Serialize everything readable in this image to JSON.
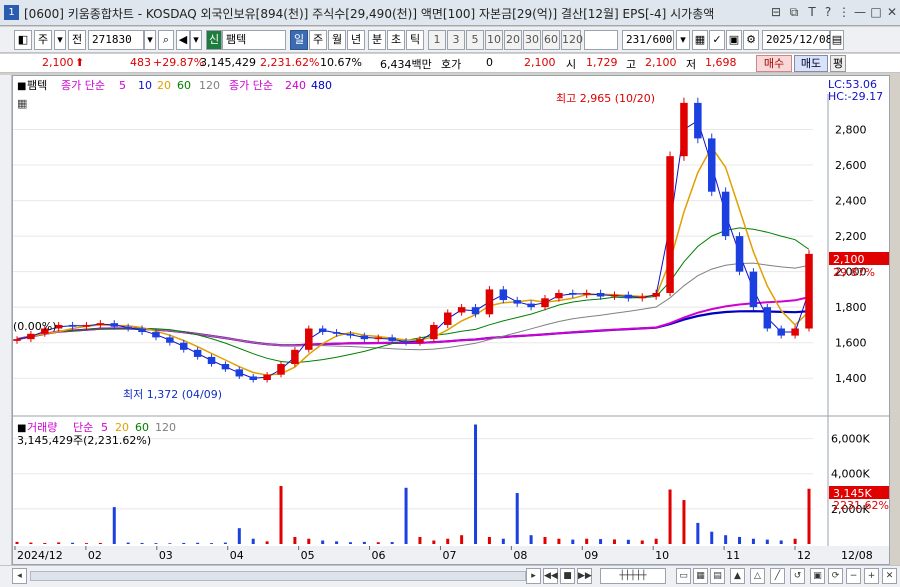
{
  "window": {
    "number": "1",
    "title": "[0600] 키움종합차트 - KOSDAQ 외국인보유[894(천)] 주식수[29,490(천)] 액면[100] 자본금[29(억)] 결산[12월] EPS[-4] 시가총액"
  },
  "toolbar": {
    "period_labels": [
      "주",
      "전"
    ],
    "code": "271830",
    "market_tag": "신",
    "stock_name": "팸텍",
    "interval_tabs": [
      "일",
      "주",
      "월",
      "년",
      "분",
      "초",
      "틱"
    ],
    "selected_interval": "일",
    "minute_options": [
      "1",
      "3",
      "5",
      "10",
      "20",
      "30",
      "60",
      "120"
    ],
    "count_display": "231/600",
    "date": "2025/12/08"
  },
  "info": {
    "price": "2,100",
    "change": "483",
    "change_pct": "+29.87%",
    "volume": "3,145,429",
    "volume_pct": "2,231.62%",
    "turnover_pct": "10.67%",
    "amount": "6,434백만",
    "quote_label": "호가",
    "quote_value": "0",
    "quote_price": "2,100",
    "open_label": "시",
    "open": "1,729",
    "high_label": "고",
    "high": "2,100",
    "low_label": "저",
    "low": "1,698",
    "buy_label": "매수",
    "sell_label": "매도",
    "flat_label": "평"
  },
  "price_panel": {
    "legend_name": "팸텍",
    "ma_short_label": "종가 단순",
    "ma_short_periods": [
      "5",
      "10",
      "20",
      "60",
      "120"
    ],
    "ma_long_label": "종가 단순",
    "ma_long_periods": [
      "240",
      "480"
    ],
    "left_pct_label": "(0.00%)",
    "lc_label": "LC:53.06",
    "hc_label": "HC:-29.17",
    "high_annotation": "최고 2,965 (10/20)",
    "low_annotation": "최저 1,372 (04/09)",
    "current_price_tag": "2,100",
    "current_pct_tag": "29.87%"
  },
  "volume_panel": {
    "legend_label": "거래량",
    "ma_label": "단순",
    "ma_periods": [
      "5",
      "20",
      "60",
      "120"
    ],
    "current_label": "3,145,429주(2,231.62%)",
    "current_tag": "3,145K",
    "current_pct_tag": "2231.62%"
  },
  "x_axis": {
    "labels": [
      "2024/12",
      "02",
      "03",
      "04",
      "05",
      "06",
      "07",
      "08",
      "09",
      "10",
      "11",
      "12"
    ],
    "right_label": "12/08"
  },
  "colors": {
    "up": "#e00000",
    "down": "#1c3fe0",
    "ma5": "#d000d0",
    "ma10": "#1010c8",
    "ma20": "#e0a000",
    "ma60": "#008000",
    "ma120": "#808080",
    "ma240": "#d000d0",
    "ma480": "#0000c0"
  },
  "chart_data": {
    "type": "candlestick",
    "price_axis": {
      "ylim": [
        1300,
        3000
      ],
      "ticks": [
        1400,
        1600,
        1800,
        2000,
        2200,
        2400,
        2600,
        2800
      ]
    },
    "volume_axis": {
      "ylim": [
        0,
        7000
      ],
      "ticks": [
        2000,
        4000,
        6000
      ],
      "tick_labels": [
        "2,000K",
        "4,000K",
        "6,000K"
      ],
      "unit": "K"
    },
    "months": [
      "2024/12",
      "02",
      "03",
      "04",
      "05",
      "06",
      "07",
      "08",
      "09",
      "10",
      "11",
      "12"
    ],
    "close_series": [
      1620,
      1650,
      1680,
      1700,
      1690,
      1700,
      1710,
      1690,
      1680,
      1660,
      1630,
      1600,
      1560,
      1520,
      1480,
      1450,
      1410,
      1390,
      1420,
      1480,
      1560,
      1680,
      1660,
      1650,
      1640,
      1620,
      1630,
      1610,
      1600,
      1620,
      1700,
      1770,
      1800,
      1760,
      1900,
      1840,
      1820,
      1800,
      1850,
      1880,
      1870,
      1880,
      1860,
      1870,
      1850,
      1860,
      1880,
      2650,
      2950,
      2750,
      2450,
      2200,
      2000,
      1800,
      1680,
      1640,
      1680,
      2100
    ],
    "volume_series_k": [
      120,
      80,
      60,
      90,
      70,
      50,
      60,
      2100,
      80,
      60,
      50,
      40,
      60,
      70,
      50,
      80,
      900,
      300,
      150,
      3300,
      400,
      300,
      200,
      150,
      100,
      120,
      100,
      110,
      3200,
      400,
      200,
      300,
      500,
      6800,
      400,
      300,
      2900,
      500,
      400,
      300,
      250,
      300,
      280,
      260,
      240,
      200,
      300,
      3100,
      2500,
      1200,
      700,
      500,
      400,
      300,
      250,
      200,
      300,
      3145
    ],
    "high": {
      "value": 2965,
      "date": "10/20"
    },
    "low": {
      "value": 1372,
      "date": "04/09"
    },
    "last": {
      "close": 2100,
      "change_pct": 29.87
    }
  }
}
